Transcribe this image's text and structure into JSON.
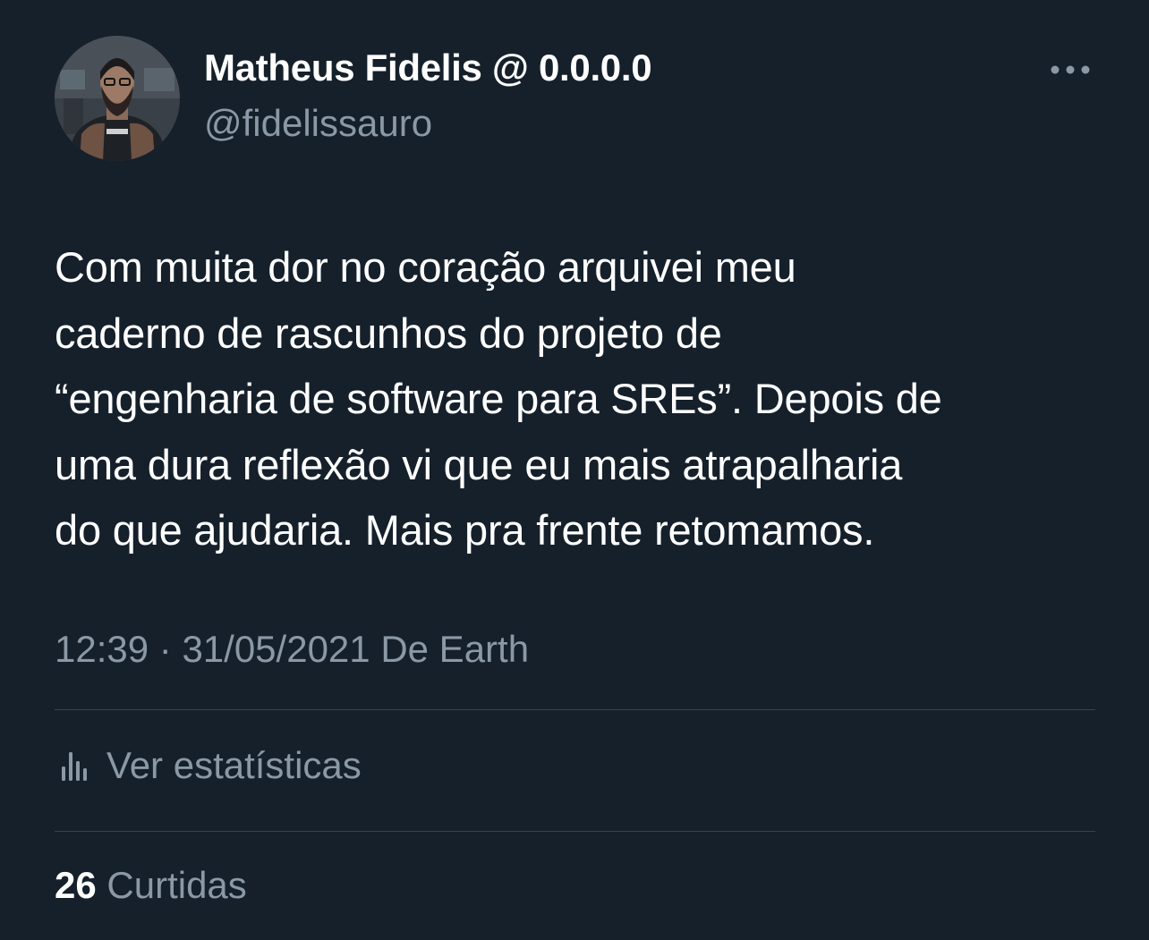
{
  "author": {
    "display_name": "Matheus Fidelis @ 0.0.0.0",
    "handle": "@fidelissauro"
  },
  "tweet": {
    "text": "Com muita dor no coração arquivei meu\ncaderno de rascunhos do projeto de\n“engenharia de software para SREs”. Depois de\numa dura reflexão vi que eu mais atrapalharia\ndo que ajudaria. Mais pra frente retomamos.",
    "time": "12:39",
    "separator": " · ",
    "date": "31/05/2021",
    "source": " De Earth"
  },
  "stats": {
    "label": "Ver estatísticas"
  },
  "likes": {
    "count": "26",
    "label": " Curtidas"
  },
  "icons": {
    "more": "more-horizontal-icon",
    "stats": "bar-chart-icon"
  },
  "colors": {
    "background": "#15202b",
    "primary_text": "#ffffff",
    "secondary_text": "#8b98a5",
    "divider": "#38444d"
  }
}
